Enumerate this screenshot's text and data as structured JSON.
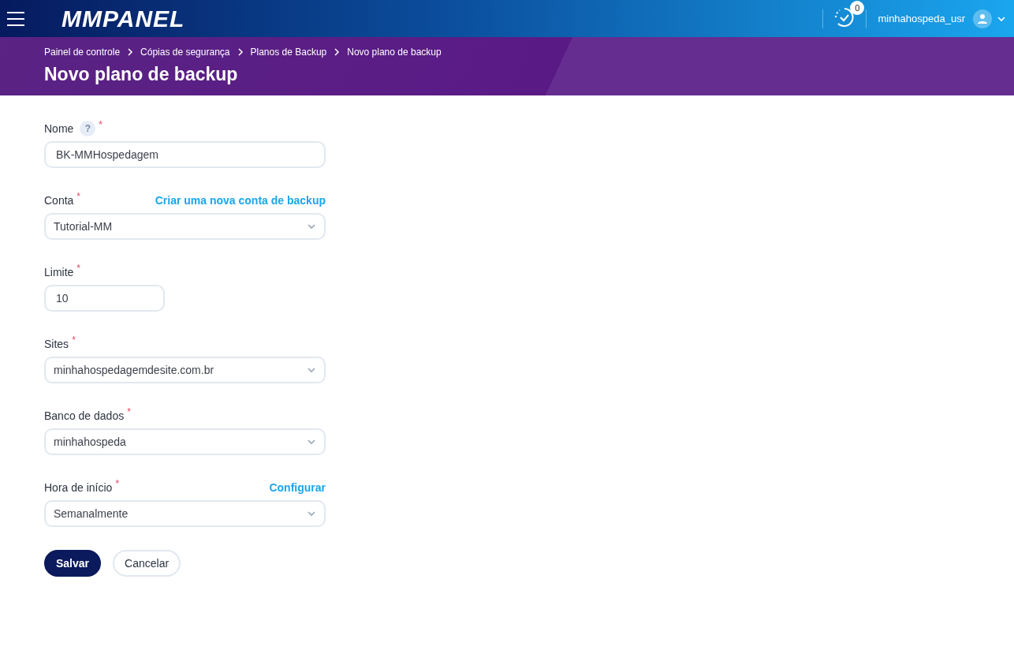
{
  "header": {
    "logo": "MMPANEL",
    "notification_count": "0",
    "username": "minhahospeda_usr"
  },
  "breadcrumb": [
    "Painel de controle",
    "Cópias de segurança",
    "Planos de Backup",
    "Novo plano de backup"
  ],
  "page_title": "Novo plano de backup",
  "form": {
    "fields": [
      {
        "kind": "text",
        "label": "Nome",
        "required_mark": "*",
        "help": "?",
        "value": "BK-MMHospedagem"
      },
      {
        "kind": "select",
        "label": "Conta",
        "required_mark": "*",
        "link": "Criar uma nova conta de backup",
        "value": "Tutorial-MM"
      },
      {
        "kind": "short",
        "label": "Limite",
        "required_mark": "*",
        "value": "10"
      },
      {
        "kind": "select",
        "label": "Sites",
        "required_mark": "*",
        "value": "minhahospedagemdesite.com.br"
      },
      {
        "kind": "select",
        "label": "Banco de dados",
        "required_mark": "*",
        "value": "minhahospeda"
      },
      {
        "kind": "select",
        "label": "Hora de início",
        "required_mark": "*",
        "link": "Configurar",
        "value": "Semanalmente"
      }
    ],
    "buttons": [
      {
        "kind": "primary",
        "label": "Salvar"
      },
      {
        "kind": "secondary",
        "label": "Cancelar"
      }
    ]
  }
}
